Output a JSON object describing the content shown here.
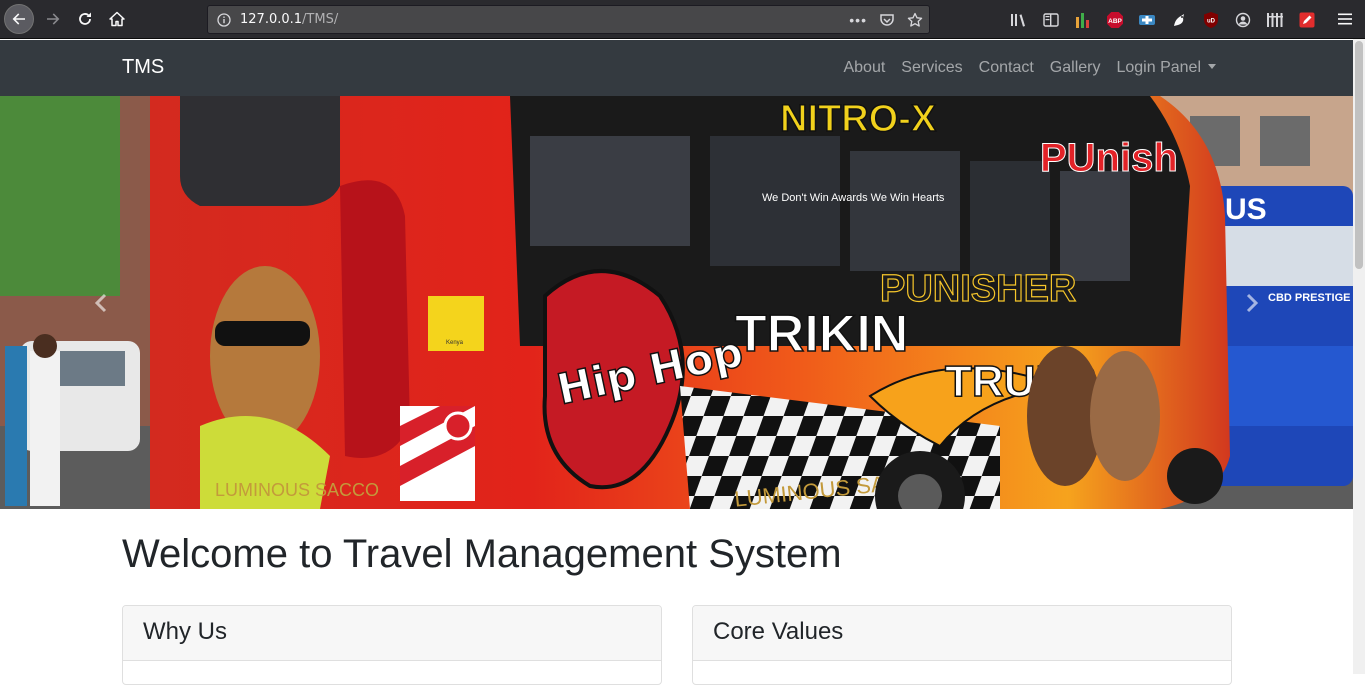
{
  "browser": {
    "url_host": "127.0.0.1",
    "url_path": "/TMS/",
    "toolbar_icons": [
      "library-icon",
      "sidebar-icon",
      "chart-extension-icon",
      "abp-extension-icon",
      "shield-extension-icon",
      "bird-extension-icon",
      "ublock-extension-icon",
      "account-icon",
      "columns-extension-icon",
      "edit-extension-icon"
    ],
    "abp_label": "ABP",
    "ublock_label": "uD"
  },
  "nav": {
    "brand": "TMS",
    "links": [
      "About",
      "Services",
      "Contact",
      "Gallery",
      "Login Panel"
    ]
  },
  "hero": {
    "bus_text_main": "TRIKIN",
    "bus_text_trucks": "TRUKS",
    "bus_text_punisher": "PUNISHER",
    "bus_text_punish": "PUnish",
    "bus_text_nitro": "NITRO-X",
    "bus_text_sacco": "LUMINOUS SACCO",
    "bus_text_sacco2": "LUMINOUS SACCO",
    "bus_text_wedont": "We Don't Win Awards We Win Hearts",
    "bus_text_hiphop": "Hip Hop",
    "right_bus_text": "US",
    "right_bus_side": "CBD PRESTIGE",
    "sign_text": "Kenya"
  },
  "main": {
    "title": "Welcome to Travel Management System",
    "cards": [
      "Why Us",
      "Core Values"
    ]
  },
  "colors": {
    "navbar": "#343a40",
    "browser": "#2a2a2e",
    "text": "#212529"
  }
}
